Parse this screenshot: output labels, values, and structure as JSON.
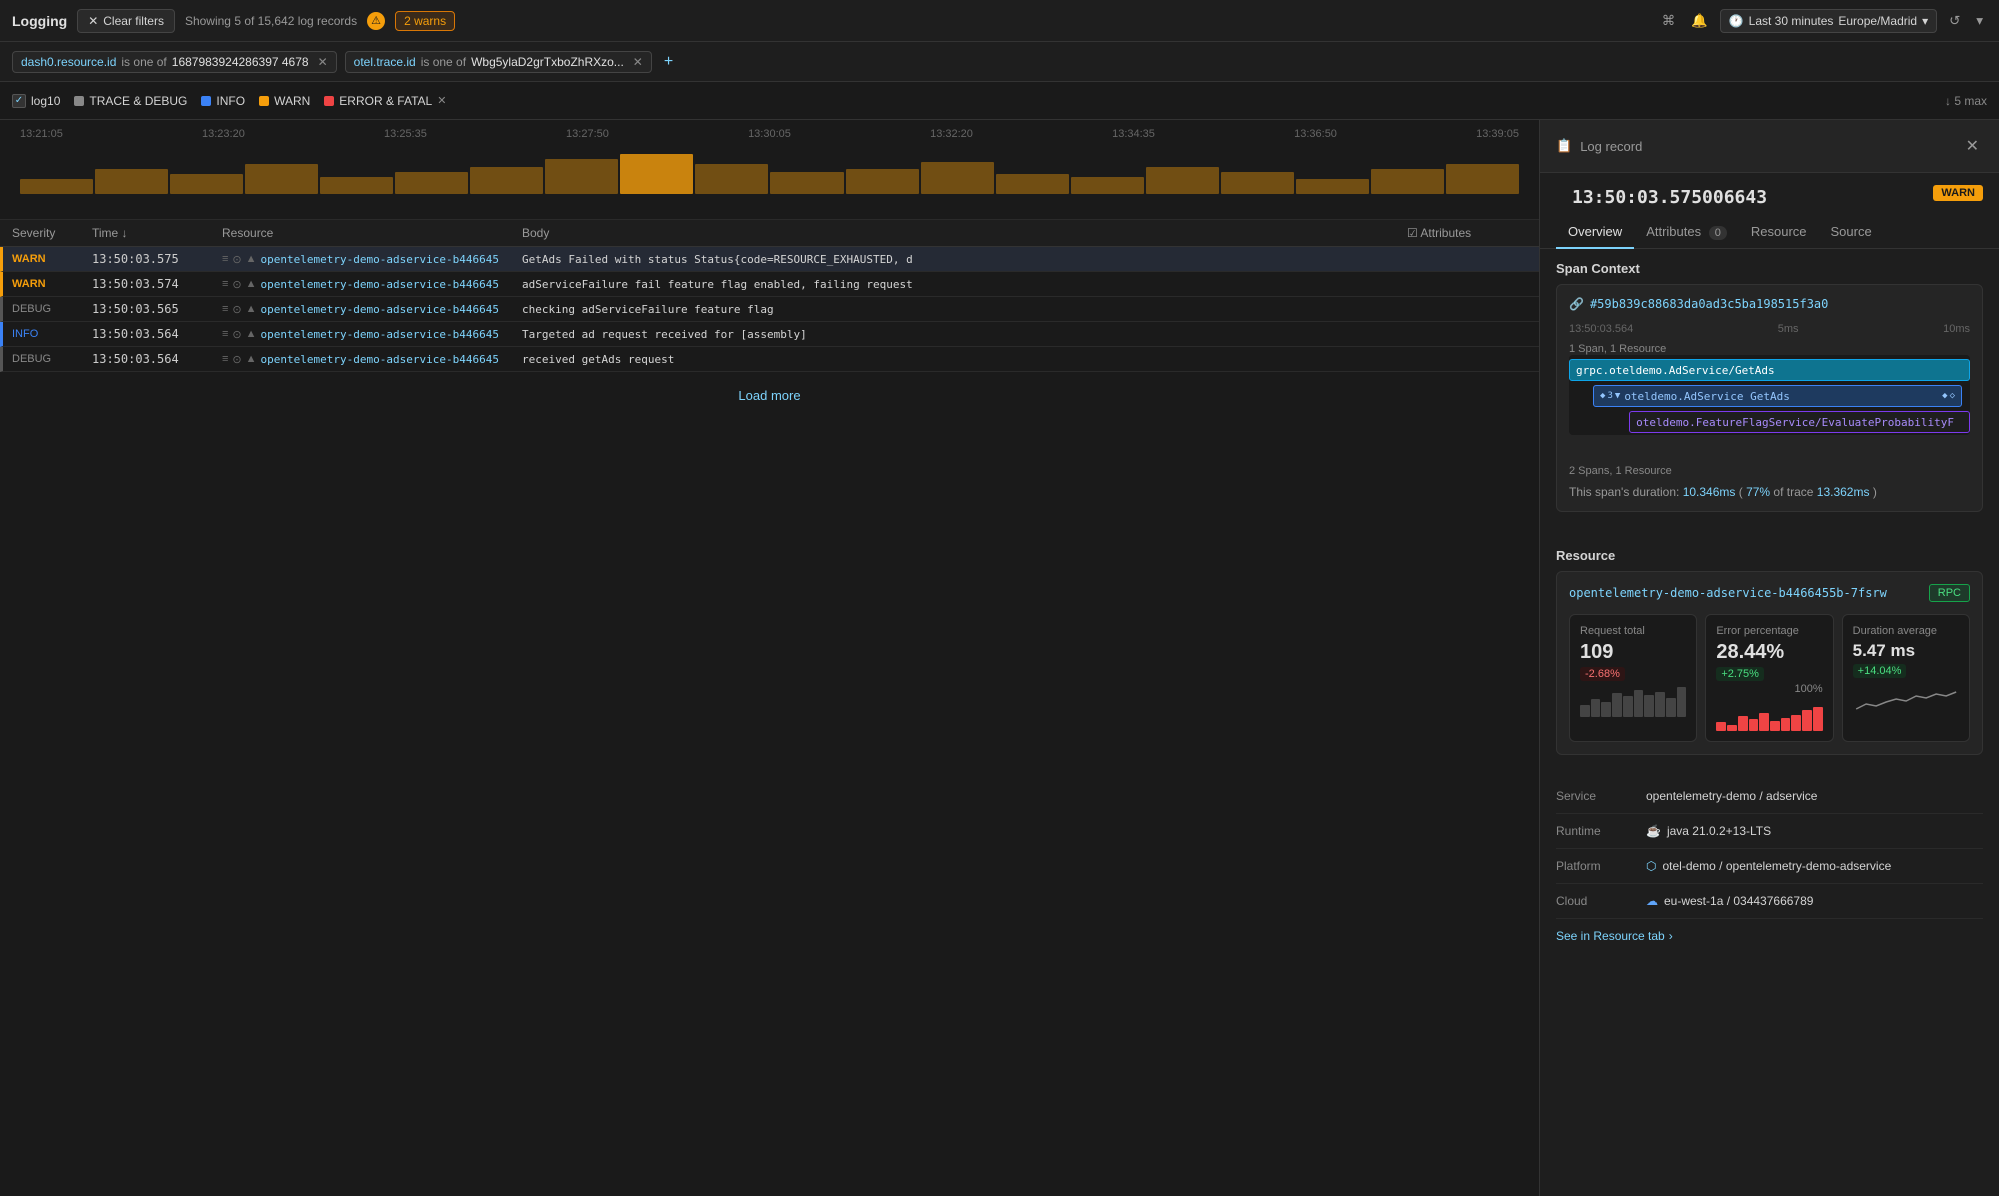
{
  "header": {
    "app_title": "Logging",
    "clear_filters_label": "Clear filters",
    "record_count": "Showing 5 of 15,642 log records",
    "warn_count": "2 warns",
    "time_range": "Last 30 minutes",
    "timezone": "Europe/Madrid"
  },
  "filters": [
    {
      "key": "dash0.resource.id",
      "op": "is one of",
      "value": "1687983924286397 4678"
    },
    {
      "key": "otel.trace.id",
      "op": "is one of",
      "value": "Wbg5ylaD2grTxboZhRXzo..."
    }
  ],
  "log_levels": [
    {
      "id": "log10",
      "label": "log10",
      "has_checkbox": true
    },
    {
      "id": "trace_debug",
      "label": "TRACE & DEBUG",
      "color": "trace"
    },
    {
      "id": "info",
      "label": "INFO",
      "color": "info"
    },
    {
      "id": "warn",
      "label": "WARN",
      "color": "warn"
    },
    {
      "id": "error_fatal",
      "label": "ERROR & FATAL",
      "color": "error"
    }
  ],
  "max_label": "5 max",
  "timeline_labels": [
    "13:21:05",
    "13:23:20",
    "13:25:35",
    "13:27:50",
    "13:30:05",
    "13:32:20",
    "13:34:35",
    "13:36:50",
    "13:39:05"
  ],
  "table": {
    "headers": [
      "Severity",
      "Time",
      "Resource",
      "Body",
      "Attributes"
    ],
    "rows": [
      {
        "severity": "WARN",
        "severity_class": "severity-warn",
        "border_class": "row-left-border-warn",
        "time": "13:50:03.575",
        "resource": "opentelemetry-demo-adservice-b446645",
        "body": "GetAds Failed with status Status{code=RESOURCE_EXHAUSTED, d",
        "selected": true
      },
      {
        "severity": "WARN",
        "severity_class": "severity-warn",
        "border_class": "row-left-border-warn",
        "time": "13:50:03.574",
        "resource": "opentelemetry-demo-adservice-b446645",
        "body": "adServiceFailure fail feature flag enabled, failing request",
        "selected": false
      },
      {
        "severity": "DEBUG",
        "severity_class": "severity-debug",
        "border_class": "row-left-border-debug",
        "time": "13:50:03.565",
        "resource": "opentelemetry-demo-adservice-b446645",
        "body": "checking adServiceFailure feature flag",
        "selected": false
      },
      {
        "severity": "INFO",
        "severity_class": "severity-info",
        "border_class": "row-left-border-info",
        "time": "13:50:03.564",
        "resource": "opentelemetry-demo-adservice-b446645",
        "body": "Targeted ad request received for [assembly]",
        "selected": false
      },
      {
        "severity": "DEBUG",
        "severity_class": "severity-debug",
        "border_class": "row-left-border-debug",
        "time": "13:50:03.564",
        "resource": "opentelemetry-demo-adservice-b446645",
        "body": "received getAds request",
        "selected": false
      }
    ]
  },
  "load_more_label": "Load more",
  "right_panel": {
    "title": "Log record",
    "timestamp": "13:50:03.575006643",
    "severity": "WARN",
    "tabs": [
      {
        "id": "overview",
        "label": "Overview",
        "active": true
      },
      {
        "id": "attributes",
        "label": "Attributes",
        "badge": "0"
      },
      {
        "id": "resource",
        "label": "Resource"
      },
      {
        "id": "source",
        "label": "Source"
      }
    ],
    "span_context": {
      "title": "Span Context",
      "trace_id": "#59b839c88683da0ad3c5ba198515f3a0",
      "timeline_start": "13:50:03.564",
      "timeline_5ms": "5ms",
      "timeline_10ms": "10ms",
      "span_info": "1 Span, 1 Resource",
      "spans": [
        {
          "label": "grpc.oteldemo.AdService/GetAds",
          "type": "primary"
        },
        {
          "label": "oteldemo.AdService GetAds",
          "type": "secondary"
        },
        {
          "label": "oteldemo.FeatureFlagService/EvaluateProbabilityF",
          "type": "tertiary"
        }
      ],
      "spans_summary": "2 Spans, 1 Resource",
      "duration": "10.346ms",
      "trace_percent": "77%",
      "trace_total": "13.362ms"
    },
    "resource": {
      "title": "Resource",
      "name": "opentelemetry-demo-adservice-b4466455b-7fsrw",
      "badge": "RPC",
      "metrics": [
        {
          "label": "Request total",
          "value": "109",
          "change": "-2.68%",
          "change_type": "neg"
        },
        {
          "label": "Error percentage",
          "value": "28.44%",
          "change": "+2.75%",
          "change_type": "pos",
          "percent_label": "100%"
        },
        {
          "label": "Duration average",
          "value": "5.47 ms",
          "change": "+14.04%",
          "change_type": "pos"
        }
      ]
    },
    "service_info": {
      "rows": [
        {
          "key": "Service",
          "value": "opentelemetry-demo / adservice"
        },
        {
          "key": "Runtime",
          "value": "java 21.0.2+13-LTS",
          "icon": "java"
        },
        {
          "key": "Platform",
          "value": "otel-demo / opentelemetry-demo-adservice",
          "icon": "otel"
        },
        {
          "key": "Cloud",
          "value": "eu-west-1a / 034437666789",
          "icon": "cloud"
        }
      ],
      "see_resource_label": "See in Resource tab"
    }
  }
}
